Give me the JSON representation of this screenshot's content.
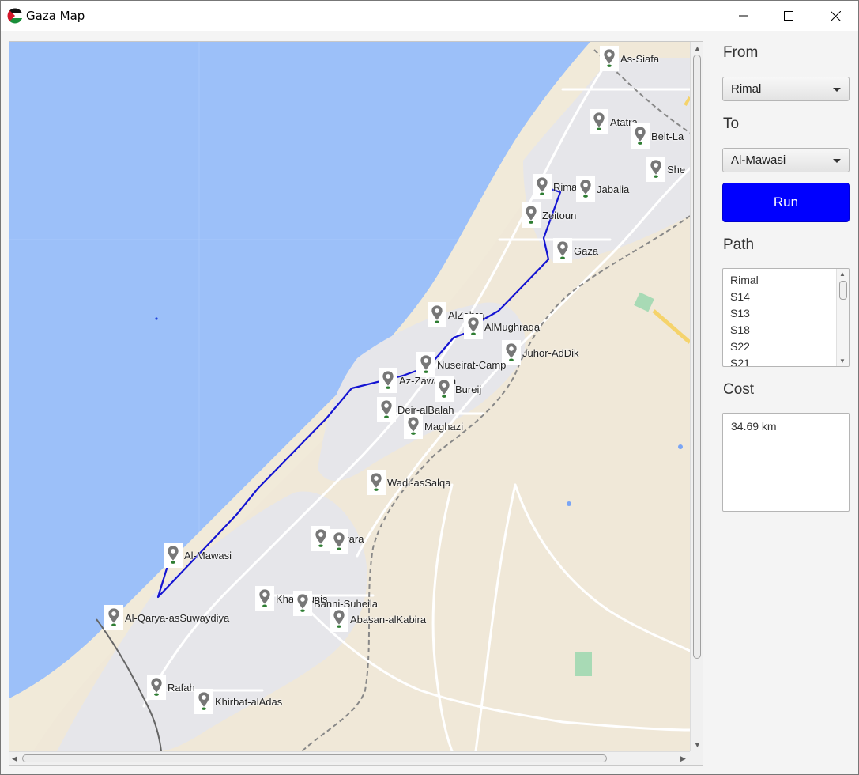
{
  "window": {
    "title": "Gaza Map"
  },
  "panel": {
    "from_label": "From",
    "from_value": "Rimal",
    "to_label": "To",
    "to_value": "Al-Mawasi",
    "run_label": "Run",
    "path_label": "Path",
    "path_items": [
      "Rimal",
      "S14",
      "S13",
      "S18",
      "S22",
      "S21"
    ],
    "cost_label": "Cost",
    "cost_value": "34.69 km"
  },
  "map": {
    "places": [
      {
        "name": "As-Siafa"
      },
      {
        "name": "Atatra"
      },
      {
        "name": "Beit-La"
      },
      {
        "name": "She"
      },
      {
        "name": "Rimal"
      },
      {
        "name": "Jabalia"
      },
      {
        "name": "Zeitoun"
      },
      {
        "name": "Gaza"
      },
      {
        "name": "AlZahra"
      },
      {
        "name": "AlMughraqa"
      },
      {
        "name": "Juhor-AdDik"
      },
      {
        "name": "Nuseirat-Camp"
      },
      {
        "name": "Az-Zawayda"
      },
      {
        "name": "Bureij"
      },
      {
        "name": "Deir-alBalah"
      },
      {
        "name": "Maghazi"
      },
      {
        "name": "Wadi-asSalqa"
      },
      {
        "name": "Qarara"
      },
      {
        "name": "Al-Mawasi"
      },
      {
        "name": "Khan Yunis"
      },
      {
        "name": "Banni-Suheila"
      },
      {
        "name": "Abasan-alKabira"
      },
      {
        "name": "Al-Qarya-asSuwaydiya"
      },
      {
        "name": "Rafah"
      },
      {
        "name": "Khirbat-alAdas"
      }
    ]
  },
  "colors": {
    "sea": "#9cc0f9",
    "land": "#f0e8d8",
    "urban": "#e8e8ec",
    "route": "#1414d2",
    "run_button": "#0000ff"
  }
}
